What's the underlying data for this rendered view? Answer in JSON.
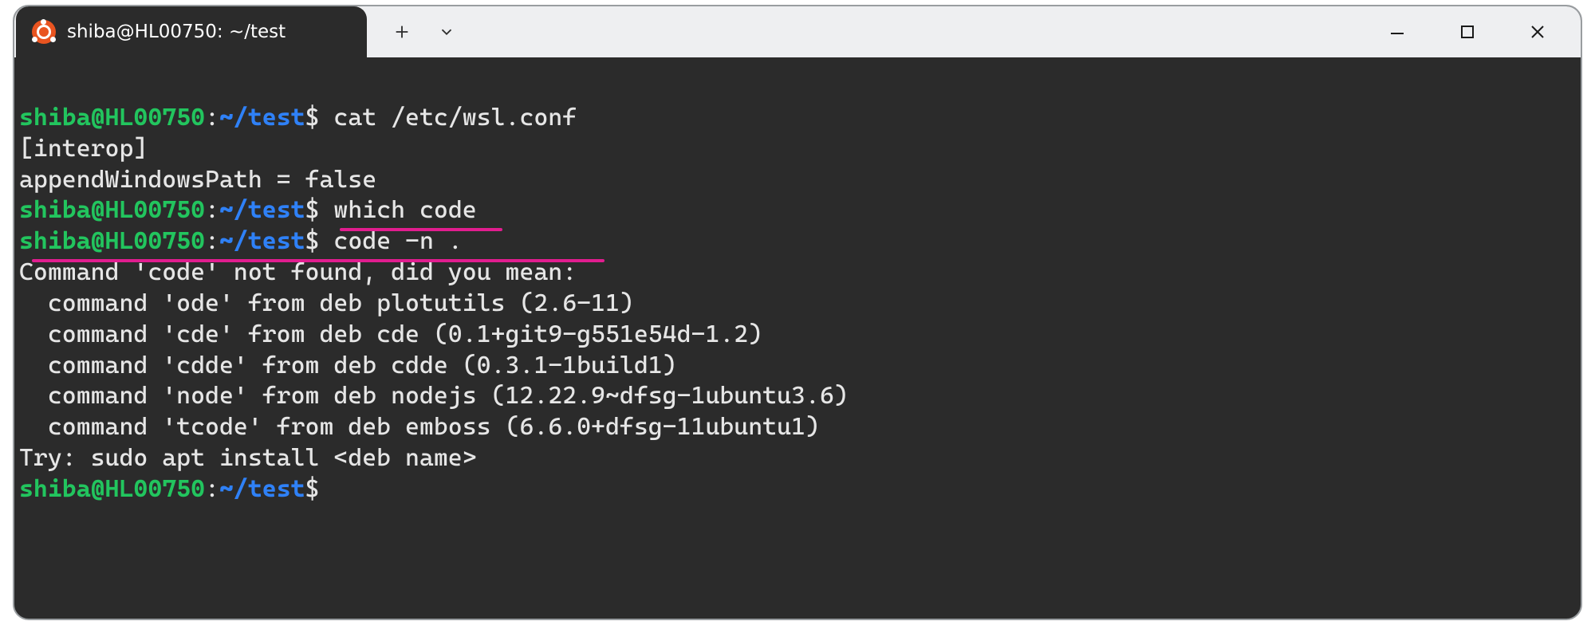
{
  "tab": {
    "title": "shiba@HL00750: ~/test",
    "icon": "ubuntu-icon"
  },
  "prompt": {
    "user_host": "shiba@HL00750",
    "colon": ":",
    "cwd": "~/test",
    "dollar": "$"
  },
  "lines": {
    "cmd1": " cat /etc/wsl.conf",
    "out1": "[interop]",
    "out2": "appendWindowsPath = false",
    "cmd2": " which code",
    "cmd3": " code -n .",
    "err_head": "Command 'code' not found, did you mean:",
    "sugg1": "  command 'ode' from deb plotutils (2.6-11)",
    "sugg2": "  command 'cde' from deb cde (0.1+git9-g551e54d-1.2)",
    "sugg3": "  command 'cdde' from deb cdde (0.3.1-1build1)",
    "sugg4": "  command 'node' from deb nodejs (12.22.9~dfsg-1ubuntu3.6)",
    "sugg5": "  command 'tcode' from deb emboss (6.6.0+dfsg-11ubuntu1)",
    "try": "Try: sudo apt install <deb name>"
  },
  "annotations": {
    "underline_cmd3": "code -n .",
    "underline_err": "Command 'code' not found, did you mean:"
  },
  "colors": {
    "bg": "#2b2b2b",
    "titlebar": "#eeeff1",
    "prompt_user": "#22c55e",
    "prompt_cwd": "#2f81f7",
    "annotation": "#e11d8f",
    "ubuntu": "#e95420"
  }
}
